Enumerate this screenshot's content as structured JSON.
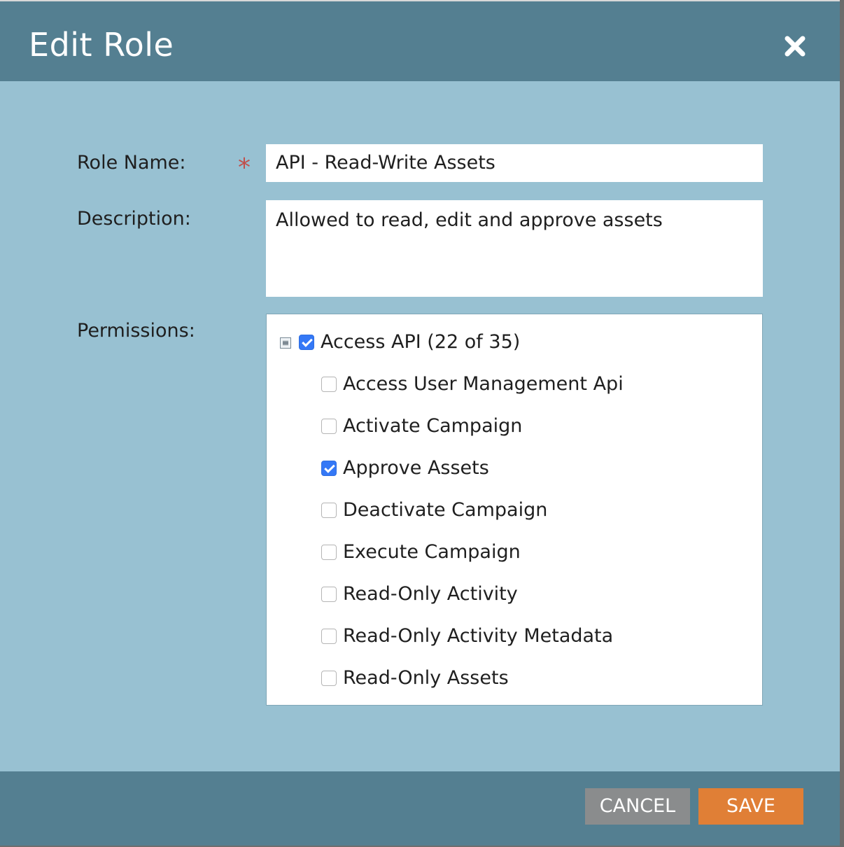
{
  "dialog": {
    "title": "Edit Role",
    "close_icon": "close-icon"
  },
  "form": {
    "role_name_label": "Role Name:",
    "required_marker": "*",
    "role_name_value": "API - Read-Write Assets",
    "description_label": "Description:",
    "description_value": "Allowed to read, edit and approve assets",
    "permissions_label": "Permissions:"
  },
  "permissions": {
    "parent": {
      "label": "Access API (22 of 35)",
      "checked": true,
      "expanded": true
    },
    "items": [
      {
        "label": "Access User Management Api",
        "checked": false
      },
      {
        "label": "Activate Campaign",
        "checked": false
      },
      {
        "label": "Approve Assets",
        "checked": true
      },
      {
        "label": "Deactivate Campaign",
        "checked": false
      },
      {
        "label": "Execute Campaign",
        "checked": false
      },
      {
        "label": "Read-Only Activity",
        "checked": false
      },
      {
        "label": "Read-Only Activity Metadata",
        "checked": false
      },
      {
        "label": "Read-Only Assets",
        "checked": false
      }
    ]
  },
  "footer": {
    "cancel_label": "CANCEL",
    "save_label": "SAVE"
  },
  "colors": {
    "header_bg": "#547f91",
    "body_bg": "#98c1d2",
    "save_button": "#e07f36",
    "cancel_button": "#8a8c8d",
    "checkbox_checked": "#3478f6",
    "required_star": "#c0504d"
  }
}
